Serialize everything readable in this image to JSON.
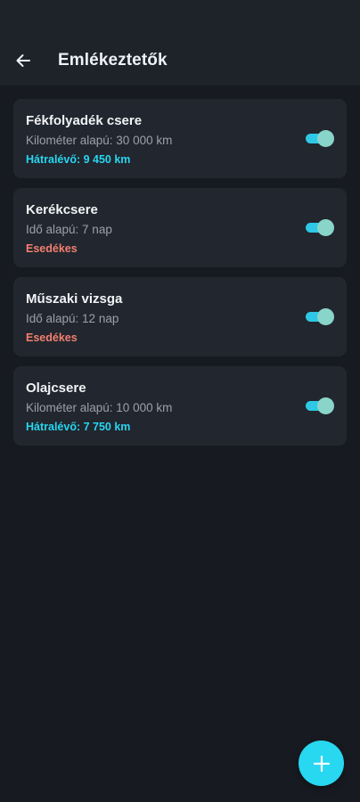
{
  "appbar": {
    "title": "Emlékeztetők",
    "back_icon": "arrow-left-icon"
  },
  "colors": {
    "accent": "#26d6ef",
    "due": "#f27f6f",
    "background": "#171b21",
    "card": "#22262e"
  },
  "reminders": [
    {
      "title": "Fékfolyadék csere",
      "subtitle": "Kilométer alapú: 30 000 km",
      "status": "Hátralévő: 9 450 km",
      "status_type": "remaining",
      "enabled": true
    },
    {
      "title": "Kerékcsere",
      "subtitle": "Idő alapú: 7 nap",
      "status": "Esedékes",
      "status_type": "due",
      "enabled": true
    },
    {
      "title": "Műszaki vizsga",
      "subtitle": "Idő alapú: 12 nap",
      "status": "Esedékes",
      "status_type": "due",
      "enabled": true
    },
    {
      "title": "Olajcsere",
      "subtitle": "Kilométer alapú: 10 000 km",
      "status": "Hátralévő: 7 750 km",
      "status_type": "remaining",
      "enabled": true
    }
  ],
  "fab": {
    "icon": "plus-icon"
  }
}
